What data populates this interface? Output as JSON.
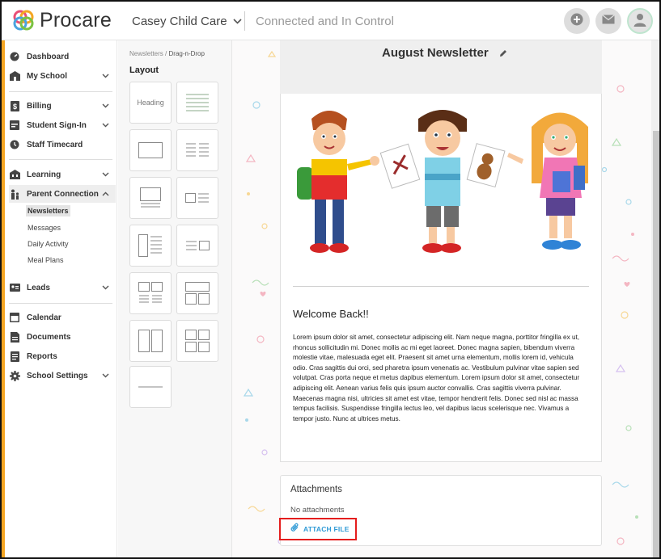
{
  "app": {
    "brand": "Procare",
    "school_name": "Casey Child Care",
    "tagline": "Connected and In Control"
  },
  "header_icons": [
    "plus-icon",
    "mail-icon",
    "user-avatar-icon"
  ],
  "colors": {
    "accent_orange": "#f5a623",
    "link_blue": "#2f9ad6",
    "highlight_red": "#e41d1d"
  },
  "sidebar": {
    "items": [
      {
        "label": "Dashboard",
        "icon": "dashboard-icon"
      },
      {
        "label": "My School",
        "icon": "school-icon"
      },
      {
        "label": "Billing",
        "icon": "billing-icon"
      },
      {
        "label": "Student Sign-In",
        "icon": "calendar-check-icon"
      },
      {
        "label": "Staff Timecard",
        "icon": "clock-icon"
      },
      {
        "label": "Learning",
        "icon": "learning-icon"
      },
      {
        "label": "Parent Connection",
        "icon": "family-icon"
      },
      {
        "label": "Leads",
        "icon": "id-card-icon"
      },
      {
        "label": "Calendar",
        "icon": "calendar-icon"
      },
      {
        "label": "Documents",
        "icon": "document-icon"
      },
      {
        "label": "Reports",
        "icon": "report-icon"
      },
      {
        "label": "School Settings",
        "icon": "gear-icon"
      }
    ],
    "sub_items": [
      "Newsletters",
      "Messages",
      "Daily Activity",
      "Meal Plans"
    ]
  },
  "layout_panel": {
    "breadcrumb_parent": "Newsletters",
    "breadcrumb_sep": "/",
    "breadcrumb_current": "Drag-n-Drop",
    "title": "Layout",
    "heading_tile": "Heading"
  },
  "newsletter": {
    "title": "August Newsletter",
    "section_heading": "Welcome Back!!",
    "body": "Lorem ipsum dolor sit amet, consectetur adipiscing elit. Nam neque magna, porttitor fringilla ex ut, rhoncus sollicitudin mi. Donec mollis ac mi eget laoreet. Donec magna sapien, bibendum viverra molestie vitae, malesuada eget elit. Praesent sit amet urna elementum, mollis lorem id, vehicula odio. Cras sagittis dui orci, sed pharetra ipsum venenatis ac. Vestibulum pulvinar vitae sapien sed volutpat. Cras porta neque et metus dapibus elementum. Lorem ipsum dolor sit amet, consectetur adipiscing elit. Aenean varius felis quis ipsum auctor convallis. Cras sagittis viverra pulvinar. Maecenas magna nisi, ultricies sit amet est vitae, tempor hendrerit felis. Donec sed nisl ac massa tempus facilisis. Suspendisse fringilla lectus leo, vel dapibus lacus scelerisque nec. Vivamus a tempor justo. Nunc at ultrices metus."
  },
  "attachments": {
    "title": "Attachments",
    "empty_text": "No attachments",
    "button_label": "ATTACH FILE"
  }
}
